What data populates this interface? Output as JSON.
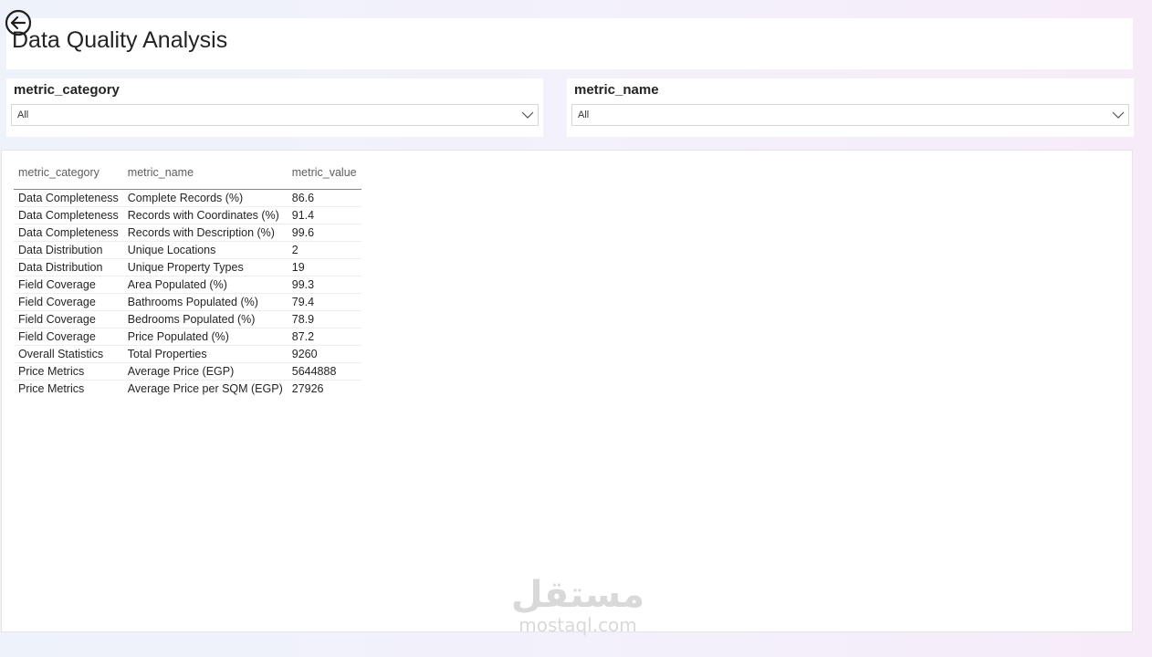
{
  "header": {
    "title": "Data Quality Analysis"
  },
  "slicers": [
    {
      "title": "metric_category",
      "value": "All"
    },
    {
      "title": "metric_name",
      "value": "All"
    }
  ],
  "table": {
    "columns": [
      "metric_category",
      "metric_name",
      "metric_value"
    ],
    "rows": [
      [
        "Data Completeness",
        "Complete Records (%)",
        "86.6"
      ],
      [
        "Data Completeness",
        "Records with Coordinates (%)",
        "91.4"
      ],
      [
        "Data Completeness",
        "Records with Description (%)",
        "99.6"
      ],
      [
        "Data Distribution",
        "Unique Locations",
        "2"
      ],
      [
        "Data Distribution",
        "Unique Property Types",
        "19"
      ],
      [
        "Field Coverage",
        "Area Populated (%)",
        "99.3"
      ],
      [
        "Field Coverage",
        "Bathrooms Populated (%)",
        "79.4"
      ],
      [
        "Field Coverage",
        "Bedrooms Populated (%)",
        "78.9"
      ],
      [
        "Field Coverage",
        "Price Populated (%)",
        "87.2"
      ],
      [
        "Overall Statistics",
        "Total Properties",
        "9260"
      ],
      [
        "Price Metrics",
        "Average Price (EGP)",
        "5644888"
      ],
      [
        "Price Metrics",
        "Average Price per SQM (EGP)",
        "27926"
      ]
    ]
  },
  "watermark": {
    "arabic": "مستقل",
    "latin": "mostaql.com"
  },
  "icons": {
    "back": "back-arrow-circle-icon",
    "dropdown": "chevron-down-icon"
  }
}
